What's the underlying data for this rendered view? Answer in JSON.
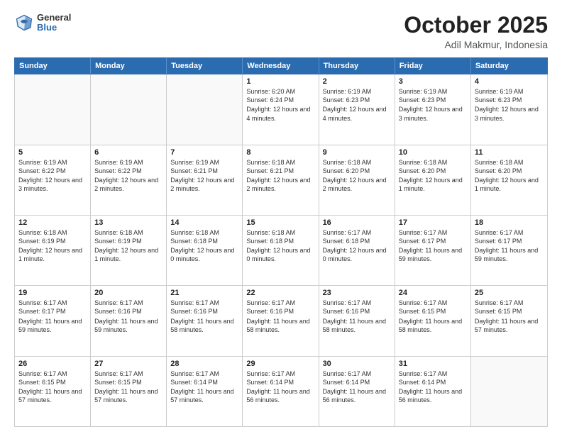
{
  "header": {
    "logo_general": "General",
    "logo_blue": "Blue",
    "month": "October 2025",
    "location": "Adil Makmur, Indonesia"
  },
  "days_of_week": [
    "Sunday",
    "Monday",
    "Tuesday",
    "Wednesday",
    "Thursday",
    "Friday",
    "Saturday"
  ],
  "weeks": [
    [
      {
        "day": "",
        "sunrise": "",
        "sunset": "",
        "daylight": ""
      },
      {
        "day": "",
        "sunrise": "",
        "sunset": "",
        "daylight": ""
      },
      {
        "day": "",
        "sunrise": "",
        "sunset": "",
        "daylight": ""
      },
      {
        "day": "1",
        "sunrise": "Sunrise: 6:20 AM",
        "sunset": "Sunset: 6:24 PM",
        "daylight": "Daylight: 12 hours and 4 minutes."
      },
      {
        "day": "2",
        "sunrise": "Sunrise: 6:19 AM",
        "sunset": "Sunset: 6:23 PM",
        "daylight": "Daylight: 12 hours and 4 minutes."
      },
      {
        "day": "3",
        "sunrise": "Sunrise: 6:19 AM",
        "sunset": "Sunset: 6:23 PM",
        "daylight": "Daylight: 12 hours and 3 minutes."
      },
      {
        "day": "4",
        "sunrise": "Sunrise: 6:19 AM",
        "sunset": "Sunset: 6:23 PM",
        "daylight": "Daylight: 12 hours and 3 minutes."
      }
    ],
    [
      {
        "day": "5",
        "sunrise": "Sunrise: 6:19 AM",
        "sunset": "Sunset: 6:22 PM",
        "daylight": "Daylight: 12 hours and 3 minutes."
      },
      {
        "day": "6",
        "sunrise": "Sunrise: 6:19 AM",
        "sunset": "Sunset: 6:22 PM",
        "daylight": "Daylight: 12 hours and 2 minutes."
      },
      {
        "day": "7",
        "sunrise": "Sunrise: 6:19 AM",
        "sunset": "Sunset: 6:21 PM",
        "daylight": "Daylight: 12 hours and 2 minutes."
      },
      {
        "day": "8",
        "sunrise": "Sunrise: 6:18 AM",
        "sunset": "Sunset: 6:21 PM",
        "daylight": "Daylight: 12 hours and 2 minutes."
      },
      {
        "day": "9",
        "sunrise": "Sunrise: 6:18 AM",
        "sunset": "Sunset: 6:20 PM",
        "daylight": "Daylight: 12 hours and 2 minutes."
      },
      {
        "day": "10",
        "sunrise": "Sunrise: 6:18 AM",
        "sunset": "Sunset: 6:20 PM",
        "daylight": "Daylight: 12 hours and 1 minute."
      },
      {
        "day": "11",
        "sunrise": "Sunrise: 6:18 AM",
        "sunset": "Sunset: 6:20 PM",
        "daylight": "Daylight: 12 hours and 1 minute."
      }
    ],
    [
      {
        "day": "12",
        "sunrise": "Sunrise: 6:18 AM",
        "sunset": "Sunset: 6:19 PM",
        "daylight": "Daylight: 12 hours and 1 minute."
      },
      {
        "day": "13",
        "sunrise": "Sunrise: 6:18 AM",
        "sunset": "Sunset: 6:19 PM",
        "daylight": "Daylight: 12 hours and 1 minute."
      },
      {
        "day": "14",
        "sunrise": "Sunrise: 6:18 AM",
        "sunset": "Sunset: 6:18 PM",
        "daylight": "Daylight: 12 hours and 0 minutes."
      },
      {
        "day": "15",
        "sunrise": "Sunrise: 6:18 AM",
        "sunset": "Sunset: 6:18 PM",
        "daylight": "Daylight: 12 hours and 0 minutes."
      },
      {
        "day": "16",
        "sunrise": "Sunrise: 6:17 AM",
        "sunset": "Sunset: 6:18 PM",
        "daylight": "Daylight: 12 hours and 0 minutes."
      },
      {
        "day": "17",
        "sunrise": "Sunrise: 6:17 AM",
        "sunset": "Sunset: 6:17 PM",
        "daylight": "Daylight: 11 hours and 59 minutes."
      },
      {
        "day": "18",
        "sunrise": "Sunrise: 6:17 AM",
        "sunset": "Sunset: 6:17 PM",
        "daylight": "Daylight: 11 hours and 59 minutes."
      }
    ],
    [
      {
        "day": "19",
        "sunrise": "Sunrise: 6:17 AM",
        "sunset": "Sunset: 6:17 PM",
        "daylight": "Daylight: 11 hours and 59 minutes."
      },
      {
        "day": "20",
        "sunrise": "Sunrise: 6:17 AM",
        "sunset": "Sunset: 6:16 PM",
        "daylight": "Daylight: 11 hours and 59 minutes."
      },
      {
        "day": "21",
        "sunrise": "Sunrise: 6:17 AM",
        "sunset": "Sunset: 6:16 PM",
        "daylight": "Daylight: 11 hours and 58 minutes."
      },
      {
        "day": "22",
        "sunrise": "Sunrise: 6:17 AM",
        "sunset": "Sunset: 6:16 PM",
        "daylight": "Daylight: 11 hours and 58 minutes."
      },
      {
        "day": "23",
        "sunrise": "Sunrise: 6:17 AM",
        "sunset": "Sunset: 6:16 PM",
        "daylight": "Daylight: 11 hours and 58 minutes."
      },
      {
        "day": "24",
        "sunrise": "Sunrise: 6:17 AM",
        "sunset": "Sunset: 6:15 PM",
        "daylight": "Daylight: 11 hours and 58 minutes."
      },
      {
        "day": "25",
        "sunrise": "Sunrise: 6:17 AM",
        "sunset": "Sunset: 6:15 PM",
        "daylight": "Daylight: 11 hours and 57 minutes."
      }
    ],
    [
      {
        "day": "26",
        "sunrise": "Sunrise: 6:17 AM",
        "sunset": "Sunset: 6:15 PM",
        "daylight": "Daylight: 11 hours and 57 minutes."
      },
      {
        "day": "27",
        "sunrise": "Sunrise: 6:17 AM",
        "sunset": "Sunset: 6:15 PM",
        "daylight": "Daylight: 11 hours and 57 minutes."
      },
      {
        "day": "28",
        "sunrise": "Sunrise: 6:17 AM",
        "sunset": "Sunset: 6:14 PM",
        "daylight": "Daylight: 11 hours and 57 minutes."
      },
      {
        "day": "29",
        "sunrise": "Sunrise: 6:17 AM",
        "sunset": "Sunset: 6:14 PM",
        "daylight": "Daylight: 11 hours and 56 minutes."
      },
      {
        "day": "30",
        "sunrise": "Sunrise: 6:17 AM",
        "sunset": "Sunset: 6:14 PM",
        "daylight": "Daylight: 11 hours and 56 minutes."
      },
      {
        "day": "31",
        "sunrise": "Sunrise: 6:17 AM",
        "sunset": "Sunset: 6:14 PM",
        "daylight": "Daylight: 11 hours and 56 minutes."
      },
      {
        "day": "",
        "sunrise": "",
        "sunset": "",
        "daylight": ""
      }
    ]
  ]
}
